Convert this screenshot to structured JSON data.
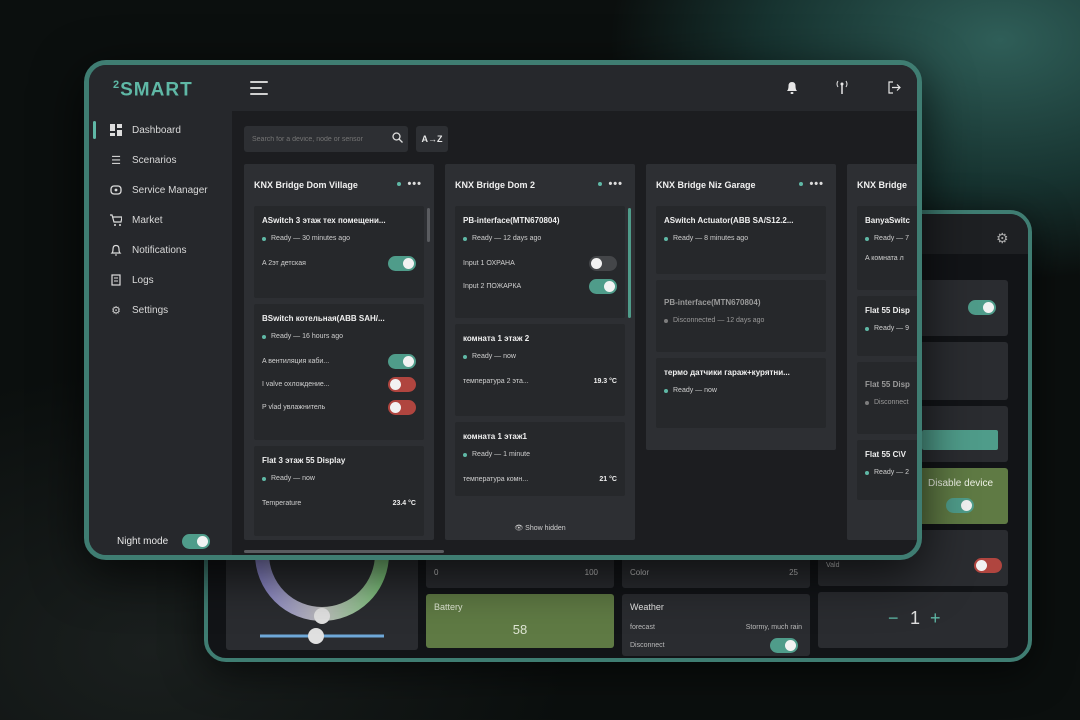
{
  "app": {
    "logo": "SMART",
    "logo_sup": "2"
  },
  "sidebar": {
    "items": [
      {
        "label": "Dashboard",
        "icon": "dashboard-icon"
      },
      {
        "label": "Scenarios",
        "icon": "list-icon"
      },
      {
        "label": "Service Manager",
        "icon": "service-icon"
      },
      {
        "label": "Market",
        "icon": "cart-icon"
      },
      {
        "label": "Notifications",
        "icon": "bell-icon"
      },
      {
        "label": "Logs",
        "icon": "logs-icon"
      },
      {
        "label": "Settings",
        "icon": "gear-icon"
      }
    ],
    "active": "Dashboard",
    "night_mode": {
      "label": "Night mode",
      "on": true
    }
  },
  "toolbar": {
    "search_placeholder": "Search for a device, node or sensor",
    "sort_label": "A→Z"
  },
  "columns": [
    {
      "title": "KNX Bridge Dom Village",
      "cards": [
        {
          "title": "ASwitch 3 этаж тех помещени...",
          "status": "Ready — 30 minutes ago",
          "rows": [
            {
              "label": "A 2эт детская",
              "toggle": "on"
            }
          ]
        },
        {
          "title": "BSwitch котельная(ABB SAH/...",
          "status": "Ready — 16 hours ago",
          "rows": [
            {
              "label": "A вентиляция каби...",
              "toggle": "on"
            },
            {
              "label": "I valve охлождение...",
              "toggle": "red"
            },
            {
              "label": "P vlad увлажнитель",
              "toggle": "red"
            }
          ]
        },
        {
          "title": "Flat 3 этаж 55 Display",
          "status": "Ready — now",
          "rows": [
            {
              "label": "Temperature",
              "value": "23.4 °C"
            }
          ]
        }
      ]
    },
    {
      "title": "KNX Bridge Dom 2",
      "cards": [
        {
          "title": "PB-interface(MTN670804)",
          "status": "Ready — 12 days ago",
          "rows": [
            {
              "label": "Input 1 ОХРАНА",
              "toggle": "off"
            },
            {
              "label": "Input 2 ПОЖАРКА",
              "toggle": "on"
            }
          ]
        },
        {
          "title": "комната 1 этаж 2",
          "status": "Ready — now",
          "rows": [
            {
              "label": "температура 2 эта...",
              "value": "19.3 °C"
            }
          ]
        },
        {
          "title": "комната 1 этаж1",
          "status": "Ready — 1 minute",
          "rows": [
            {
              "label": "температура комн...",
              "value": "21 °C"
            }
          ]
        }
      ],
      "show_hidden": "Show hidden"
    },
    {
      "title": "KNX Bridge Niz Garage",
      "cards": [
        {
          "title": "ASwitch Actuator(ABB SA/S12.2...",
          "status": "Ready — 8 minutes ago",
          "rows": []
        },
        {
          "title": "PB-interface(MTN670804)",
          "status": "Disconnected — 12 days ago",
          "status_state": "grey",
          "rows": []
        },
        {
          "title": "термо датчики гараж+курятни...",
          "status": "Ready — now",
          "rows": []
        }
      ]
    },
    {
      "title": "KNX Bridge",
      "cards": [
        {
          "title": "BanyaSwitc",
          "status": "Ready — 7",
          "rows": [
            {
              "label": "A комната л"
            }
          ]
        },
        {
          "title": "Flat 55 Disp",
          "status": "Ready — 9",
          "rows": []
        },
        {
          "title": "Flat 55 Disp",
          "status": "Disconnect",
          "status_state": "grey",
          "rows": []
        },
        {
          "title": "Flat 55 C\\V",
          "status": "Ready — 2",
          "rows": []
        }
      ]
    }
  ],
  "back_panel": {
    "slider_min": "0",
    "slider_max": "100",
    "color_label": "Color",
    "color_value": "25",
    "battery_label": "Battery",
    "battery_value": "58",
    "weather_title": "Weather",
    "weather_forecast_label": "forecast",
    "weather_forecast_value": "Stormy, much rain",
    "disconnect_label": "Disconnect",
    "disable_device": "Disable device",
    "vald": "Vald",
    "counter_value": "1",
    "minus": "−",
    "plus": "+"
  },
  "colors": {
    "accent": "#5fb8a6",
    "frame": "#3f7d72",
    "green_panel": "#5f7a44",
    "red_toggle": "#b0453f"
  }
}
